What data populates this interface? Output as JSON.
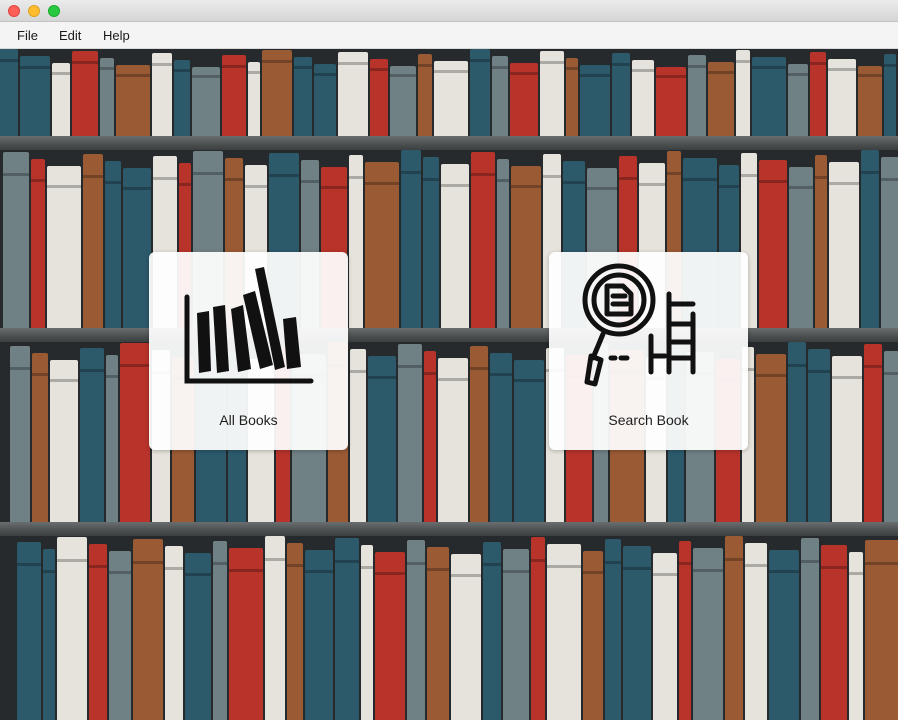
{
  "window": {
    "controls": [
      "close",
      "minimize",
      "maximize"
    ]
  },
  "menubar": {
    "items": [
      {
        "label": "File"
      },
      {
        "label": "Edit"
      },
      {
        "label": "Help"
      }
    ]
  },
  "main": {
    "cards": [
      {
        "label": "All Books",
        "icon": "bar-chart-icon"
      },
      {
        "label": "Search Book",
        "icon": "search-document-icon"
      }
    ]
  },
  "colors": {
    "book_blue": "#2c5a6b",
    "book_red": "#b8332a",
    "book_brown": "#9a5a34",
    "book_gray": "#6f8184",
    "book_white": "#e6e3dc"
  }
}
